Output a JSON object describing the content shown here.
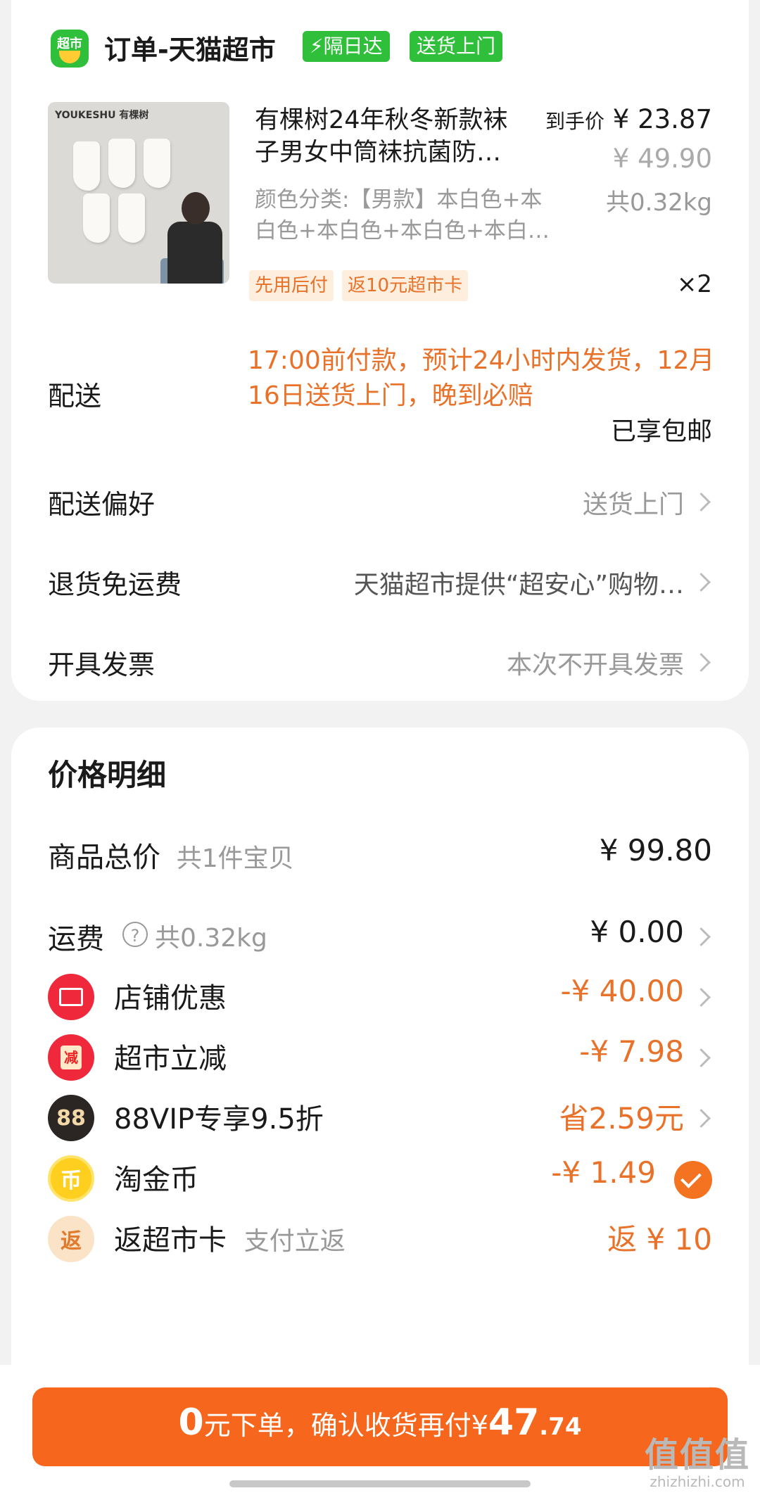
{
  "store": {
    "logo_text": "超市",
    "name": "订单-天猫超市",
    "tag_next_day": "⚡隔日达",
    "tag_door": "送货上门"
  },
  "product": {
    "thumb_brand": "YOUKESHU 有棵树",
    "title_line1": "有棵树24年秋冬新款袜",
    "title_line2": "子男女中筒袜抗菌防…",
    "spec_line1": "颜色分类:【男款】本白色+本",
    "spec_line2": "白色+本白色+本白色+本白…",
    "price_label": "到手价",
    "price_final": "¥ 23.87",
    "price_orig": "¥ 49.90",
    "weight": "共0.32kg",
    "tag_pay_later": "先用后付",
    "tag_card": "返10元超市卡",
    "qty": "×2"
  },
  "delivery": {
    "label": "配送",
    "info": "17:00前付款，预计24小时内发货，12月16日送货上门，晚到必赔",
    "free_shipping": "已享包邮"
  },
  "rows": {
    "preference_label": "配送偏好",
    "preference_value": "送货上门",
    "return_label": "退货免运费",
    "return_value": "天猫超市提供“超安心”购物…",
    "invoice_label": "开具发票",
    "invoice_value": "本次不开具发票"
  },
  "price_detail": {
    "title": "价格明细",
    "goods_label": "商品总价",
    "goods_sub": "共1件宝贝",
    "goods_amount": "¥ 99.80",
    "freight_label": "运费",
    "freight_sub": "共0.32kg",
    "freight_amount": "¥ 0.00",
    "shop_label": "店铺优惠",
    "shop_amount": "-¥ 40.00",
    "market_label": "超市立减",
    "market_icon": "减",
    "market_amount": "-¥ 7.98",
    "vip_icon": "88",
    "vip_label": "88VIP专享9.5折",
    "vip_amount": "省2.59元",
    "coin_icon": "币",
    "coin_label": "淘金币",
    "coin_amount": "-¥ 1.49",
    "card_icon": "返",
    "card_label": "返超市卡",
    "card_sub": "支付立返",
    "card_amount": "返 ¥ 10"
  },
  "submit": {
    "zero": "0",
    "text": "元下单，确认收货再付",
    "currency": "¥",
    "int": "47",
    "dec": ".74"
  },
  "watermark": {
    "main": "值值值",
    "sub": "zhizhizhi.com"
  },
  "colors": {
    "accent": "#f6661c",
    "orange_text": "#e8722a",
    "green_tag": "#2fbf3a"
  }
}
